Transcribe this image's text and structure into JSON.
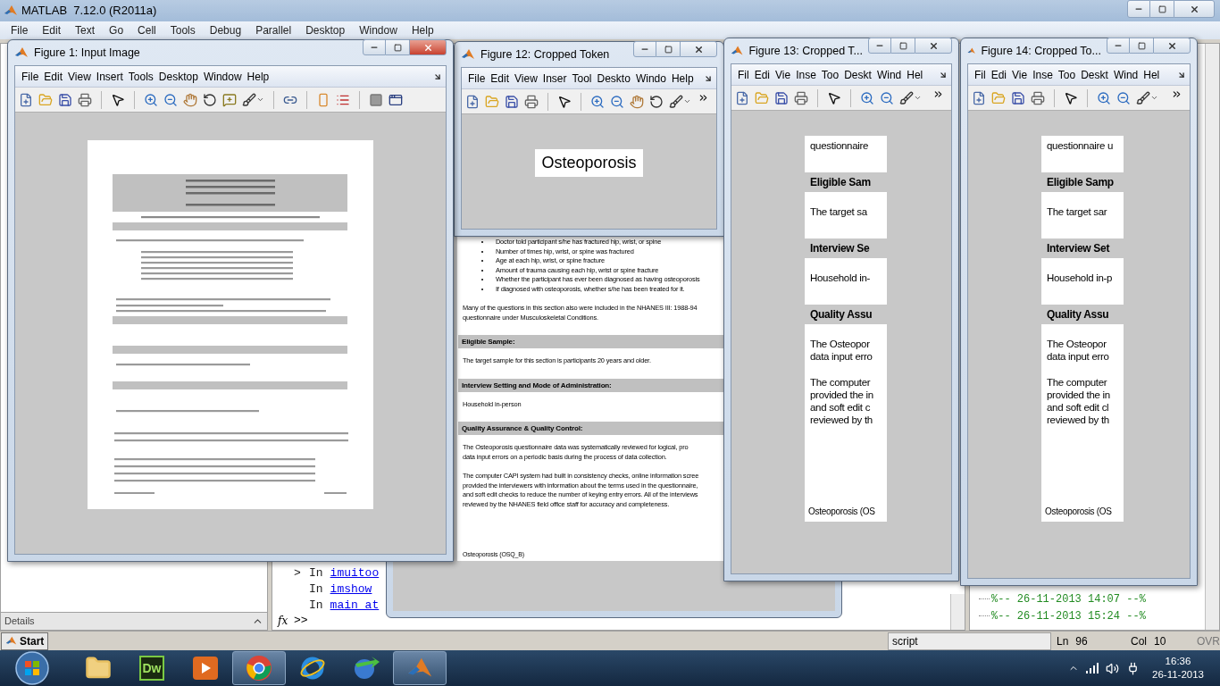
{
  "main_window": {
    "title": "MATLAB  7.12.0 (R2011a)",
    "menu": [
      "File",
      "Edit",
      "Text",
      "Go",
      "Cell",
      "Tools",
      "Debug",
      "Parallel",
      "Desktop",
      "Window",
      "Help"
    ]
  },
  "left_panel": {
    "details_label": "Details"
  },
  "command_window": {
    "fx_label": "fx",
    "lines": [
      {
        "marker": ">",
        "text": "In",
        "link": "imuitoo"
      },
      {
        "text": "In",
        "link": "imshow"
      },
      {
        "text": "In",
        "link": "main_at"
      }
    ],
    "prompt": ">>"
  },
  "command_history": [
    "%-- 26-11-2013 14:07 --%",
    "%-- 26-11-2013 15:24 --%"
  ],
  "background_figure": {
    "content": {
      "kind": "page_partial",
      "blocks": [
        {
          "kind": "bullets",
          "items": [
            "Doctor told participant s/he has fractured hip, wrist, or spine",
            "Number of times hip, wrist, or spine was fractured",
            "Age at each hip, wrist, or spine fracture",
            "Amount of trauma causing each hip, wrist or spine fracture",
            "Whether the participant has ever been diagnosed as having osteoporosis",
            "If diagnosed with osteoporosis, whether s/he has been treated for it."
          ]
        },
        {
          "kind": "paragraph",
          "lines": [
            "Many of the questions in this section also were included in the NHANES III: 1988-94",
            "questionnaire under Musculoskeletal Conditions."
          ]
        },
        {
          "kind": "heading",
          "text": "Eligible Sample:"
        },
        {
          "kind": "paragraph",
          "lines": [
            "The target sample for this section is participants 20 years and older."
          ]
        },
        {
          "kind": "heading",
          "text": "Interview Setting and Mode of Administration:"
        },
        {
          "kind": "paragraph",
          "lines": [
            "Household in-person"
          ]
        },
        {
          "kind": "heading",
          "text": "Quality Assurance & Quality Control:"
        },
        {
          "kind": "paragraph",
          "lines": [
            "The Osteoporosis questionnaire data was systematically reviewed for logical, pro",
            "data input errors on a periodic basis during the process of data collection."
          ]
        },
        {
          "kind": "paragraph",
          "lines": [
            "The computer CAPI system had built in consistency checks, online information scree",
            "provided the interviewers with information about the terms used in the questionnaire,",
            "and soft edit checks to reduce the number of keying entry errors. All of the interviews",
            "reviewed by the NHANES field office staff for accuracy and completeness."
          ]
        }
      ],
      "footer_left": "Osteoporosis (OSQ_B)"
    }
  },
  "figures": [
    {
      "title": "Figure 1: Input Image",
      "active": true,
      "menu": [
        "File",
        "Edit",
        "View",
        "Insert",
        "Tools",
        "Desktop",
        "Window",
        "Help"
      ],
      "toolbar": {
        "kind": "full"
      },
      "content": {
        "kind": "page_image"
      }
    },
    {
      "title": "Figure 12: Cropped Token",
      "active": false,
      "menu": [
        "File",
        "Edit",
        "View",
        "Inser",
        "Tool",
        "Deskto",
        "Windo",
        "Help"
      ],
      "toolbar": {
        "kind": "compact"
      },
      "content": {
        "kind": "token",
        "text": "Osteoporosis"
      }
    },
    {
      "title": "Figure 13: Cropped T...",
      "active": false,
      "menu": [
        "Fil",
        "Edi",
        "Vie",
        "Inse",
        "Too",
        "Deskt",
        "Wind",
        "Hel"
      ],
      "toolbar": {
        "kind": "short"
      },
      "content": {
        "kind": "strip",
        "blocks": [
          {
            "kind": "paragraph",
            "lines": [
              "questionnaire"
            ]
          },
          {
            "kind": "heading",
            "text": "Eligible Sam"
          },
          {
            "kind": "paragraph",
            "lines": [
              "The target sa"
            ]
          },
          {
            "kind": "heading",
            "text": "Interview Se"
          },
          {
            "kind": "paragraph",
            "lines": [
              "Household in-"
            ]
          },
          {
            "kind": "heading",
            "text": "Quality Assu"
          },
          {
            "kind": "paragraph",
            "lines": [
              "The Osteopor",
              "data input erro"
            ]
          },
          {
            "kind": "paragraph",
            "lines": [
              "The computer",
              "provided the in",
              "and soft edit c",
              "reviewed by th"
            ]
          }
        ],
        "footer_left": "Osteoporosis (OS"
      }
    },
    {
      "title": "Figure 14: Cropped To...",
      "active": false,
      "menu": [
        "Fil",
        "Edi",
        "Vie",
        "Inse",
        "Too",
        "Deskt",
        "Wind",
        "Hel"
      ],
      "toolbar": {
        "kind": "short"
      },
      "content": {
        "kind": "strip",
        "blocks": [
          {
            "kind": "paragraph",
            "lines": [
              "questionnaire u"
            ]
          },
          {
            "kind": "heading",
            "text": "Eligible Samp"
          },
          {
            "kind": "paragraph",
            "lines": [
              "The target sar"
            ]
          },
          {
            "kind": "heading",
            "text": "Interview Set"
          },
          {
            "kind": "paragraph",
            "lines": [
              "Household in-p"
            ]
          },
          {
            "kind": "heading",
            "text": "Quality Assu"
          },
          {
            "kind": "paragraph",
            "lines": [
              "The Osteopor",
              "data input erro"
            ]
          },
          {
            "kind": "paragraph",
            "lines": [
              "The computer",
              "provided the in",
              "and soft edit cl",
              "reviewed by th"
            ]
          }
        ],
        "footer_left": "Osteoporosis (OS"
      }
    }
  ],
  "status_bar": {
    "start": "Start",
    "mode": "script",
    "line_label": "Ln",
    "line": "96",
    "col_label": "Col",
    "col": "10",
    "overwrite": "OVR"
  },
  "taskbar": {
    "apps": [
      {
        "kind": "folder",
        "running": false
      },
      {
        "kind": "dw",
        "label": "Dw",
        "running": false
      },
      {
        "kind": "media",
        "running": false
      },
      {
        "kind": "browser",
        "running": true
      },
      {
        "kind": "orbit",
        "running": false
      },
      {
        "kind": "download",
        "running": false
      },
      {
        "kind": "matlab",
        "running": true
      }
    ],
    "time": "16:36",
    "date": "26-11-2013"
  }
}
